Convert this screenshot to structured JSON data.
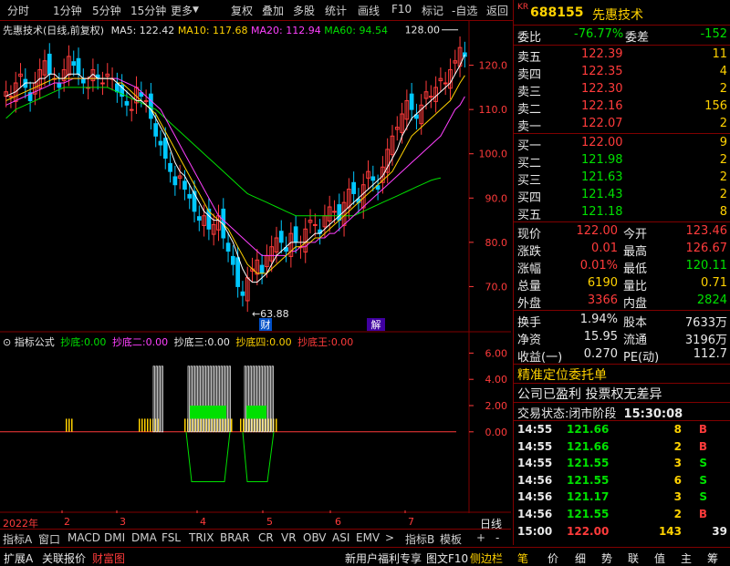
{
  "toolbar": {
    "left_items": [
      "分时",
      "1分钟",
      "5分钟",
      "15分钟",
      "更多"
    ],
    "right_items": [
      "复权",
      "叠加",
      "多股",
      "统计",
      "画线",
      "F10",
      "标记",
      "-自选",
      "返回"
    ]
  },
  "chart": {
    "stock_title": "先惠技术(日线,前复权)",
    "ma": [
      {
        "label": "MA5: 122.42",
        "color": "#ffffff"
      },
      {
        "label": "MA10: 117.68",
        "color": "#ffd200"
      },
      {
        "label": "MA20: 112.94",
        "color": "#ff40ff"
      },
      {
        "label": "MA60: 94.54",
        "color": "#00e000"
      }
    ],
    "high_label": "128.00",
    "low_label": "63.88",
    "markers": [
      "财",
      "解"
    ],
    "yaxis_ticks": [
      "120.0",
      "110.0",
      "100.0",
      "90.0",
      "80.0",
      "70.0"
    ],
    "indicator": {
      "name": "指标公式",
      "series": [
        {
          "label": "抄底:",
          "value": "0.00",
          "color": "#00e000"
        },
        {
          "label": "抄底二:",
          "value": "0.00",
          "color": "#ff40ff"
        },
        {
          "label": "抄底三:",
          "value": "0.00",
          "color": "#e8e8e8"
        },
        {
          "label": "抄底四:",
          "value": "0.00",
          "color": "#ffd200"
        },
        {
          "label": "抄底王:",
          "value": "0.00",
          "color": "#ff3b3b"
        }
      ],
      "yaxis_ticks": [
        "6.00",
        "4.00",
        "2.00",
        "0.00"
      ]
    },
    "xaxis": {
      "year": "2022年",
      "months": [
        "2",
        "3",
        "4",
        "5",
        "6",
        "7"
      ],
      "period": "日线"
    }
  },
  "chart_data": {
    "type": "candlestick",
    "title": "先惠技术(日线,前复权)",
    "ylim": [
      60,
      130
    ],
    "max_high": 128.0,
    "min_low": 63.88,
    "ma_last": {
      "MA5": 122.42,
      "MA10": 117.68,
      "MA20": 112.94,
      "MA60": 94.54
    },
    "close_series": [
      114,
      113,
      116,
      118,
      115,
      112,
      116,
      119,
      121,
      118,
      117,
      115,
      119,
      122,
      120,
      118,
      116,
      115,
      119,
      117,
      116,
      118,
      117,
      114,
      113,
      111,
      110,
      115,
      113,
      112,
      108,
      104,
      102,
      99,
      96,
      93,
      95,
      92,
      90,
      87,
      85,
      86,
      83,
      84,
      86,
      81,
      78,
      75,
      70,
      68,
      72,
      74,
      76,
      73,
      77,
      79,
      81,
      80,
      78,
      82,
      80,
      79,
      83,
      85,
      84,
      82,
      86,
      88,
      87,
      85,
      89,
      92,
      91,
      89,
      93,
      96,
      94,
      92,
      97,
      101,
      104,
      106,
      109,
      112,
      110,
      108,
      111,
      114,
      113,
      115,
      117,
      116,
      119,
      121,
      124,
      122
    ],
    "ma5": [
      113,
      113.5,
      114,
      115,
      116,
      116,
      116,
      117,
      117,
      118,
      118,
      117,
      117,
      118,
      118,
      118,
      117,
      117,
      118,
      117,
      117,
      117,
      117,
      116,
      115,
      114,
      113,
      112,
      112,
      111,
      110,
      108,
      106,
      104,
      101,
      98,
      96,
      95,
      93,
      91,
      89,
      87,
      86,
      85,
      85,
      84,
      82,
      80,
      77,
      74,
      72,
      71,
      71,
      72,
      73,
      75,
      77,
      78,
      79,
      80,
      80,
      80,
      80,
      81,
      82,
      82,
      83,
      84,
      85,
      86,
      87,
      88,
      89,
      90,
      91,
      92,
      93,
      94,
      95,
      97,
      99,
      101,
      104,
      106,
      108,
      109,
      110,
      111,
      112,
      113,
      114,
      115,
      116,
      118,
      120,
      122.42
    ],
    "ma10": [
      112,
      112.5,
      113,
      113.5,
      114,
      114.5,
      115,
      115.5,
      116,
      116.5,
      117,
      117,
      117,
      117,
      117,
      117,
      117,
      117,
      117,
      117,
      117,
      117,
      117,
      116,
      116,
      115,
      114,
      113,
      112,
      111,
      110,
      109,
      107,
      105,
      103,
      101,
      99,
      97,
      95,
      93,
      91,
      89,
      87,
      86,
      85,
      84,
      83,
      81,
      79,
      77,
      75,
      74,
      73,
      73,
      73,
      74,
      75,
      76,
      77,
      78,
      79,
      79,
      80,
      80,
      81,
      81,
      82,
      83,
      84,
      85,
      86,
      87,
      88,
      89,
      90,
      91,
      92,
      93,
      94,
      95,
      96,
      98,
      100,
      102,
      104,
      105,
      106,
      107,
      108,
      109,
      110,
      111,
      112,
      114,
      116,
      117.68
    ],
    "ma20": [
      111,
      111.5,
      112,
      112.5,
      113,
      113.5,
      114,
      114.5,
      115,
      115.5,
      116,
      116,
      116,
      116.5,
      117,
      117,
      117,
      117,
      117,
      117,
      117,
      117,
      117,
      117,
      116.5,
      116,
      115.5,
      115,
      114,
      113,
      112,
      111,
      110,
      108,
      106,
      104,
      102,
      100,
      98,
      96,
      94,
      92,
      90,
      88,
      86,
      85,
      84,
      83,
      82,
      81,
      80,
      79,
      78,
      77,
      77,
      77,
      77,
      77,
      77,
      78,
      78,
      79,
      79,
      80,
      80,
      81,
      81,
      82,
      82,
      83,
      84,
      85,
      86,
      87,
      88,
      89,
      90,
      91,
      92,
      93,
      94,
      95,
      96,
      97,
      98,
      99,
      100,
      101,
      102,
      103,
      104,
      106,
      108,
      110,
      111,
      112.94
    ],
    "ma60": [
      108,
      109,
      110,
      110.5,
      111,
      111.5,
      112,
      112.5,
      113,
      113.5,
      114,
      114.5,
      115,
      115,
      115,
      115,
      115,
      115,
      115,
      115,
      115,
      115,
      114.5,
      114,
      113.5,
      113,
      112.5,
      112,
      111.5,
      111,
      110.5,
      110,
      109,
      108,
      107,
      106,
      105,
      104,
      103,
      102,
      101,
      100,
      99,
      98,
      97,
      96,
      95,
      94,
      93,
      92,
      91,
      90.5,
      90,
      89.5,
      89,
      88.5,
      88,
      87.5,
      87,
      86.5,
      86,
      86,
      86,
      86,
      86,
      86,
      86,
      86,
      86,
      86,
      86,
      86,
      86,
      86.5,
      87,
      87.5,
      88,
      88.5,
      89,
      89.5,
      90,
      90.5,
      91,
      91.5,
      92,
      92.5,
      93,
      93.5,
      94,
      94.3,
      94.54
    ]
  },
  "quote": {
    "code": "688155",
    "name": "先惠技术",
    "kr_badge": "KR",
    "weibi_label": "委比",
    "weibi_value": "-76.77%",
    "weicha_label": "委差",
    "weicha_value": "-152",
    "asks": [
      {
        "label": "卖五",
        "price": "122.39",
        "vol": "11"
      },
      {
        "label": "卖四",
        "price": "122.35",
        "vol": "4"
      },
      {
        "label": "卖三",
        "price": "122.30",
        "vol": "2"
      },
      {
        "label": "卖二",
        "price": "122.16",
        "vol": "156"
      },
      {
        "label": "卖一",
        "price": "122.07",
        "vol": "2"
      }
    ],
    "bids": [
      {
        "label": "买一",
        "price": "122.00",
        "vol": "9"
      },
      {
        "label": "买二",
        "price": "121.98",
        "vol": "2"
      },
      {
        "label": "买三",
        "price": "121.63",
        "vol": "2"
      },
      {
        "label": "买四",
        "price": "121.43",
        "vol": "2"
      },
      {
        "label": "买五",
        "price": "121.18",
        "vol": "8"
      }
    ],
    "stats": [
      {
        "l1": "现价",
        "v1": "122.00",
        "c1": "red",
        "l2": "今开",
        "v2": "123.46",
        "c2": "red"
      },
      {
        "l1": "涨跌",
        "v1": "0.01",
        "c1": "red",
        "l2": "最高",
        "v2": "126.67",
        "c2": "red"
      },
      {
        "l1": "涨幅",
        "v1": "0.01%",
        "c1": "red",
        "l2": "最低",
        "v2": "120.11",
        "c2": "green"
      },
      {
        "l1": "总量",
        "v1": "6190",
        "c1": "yellow",
        "l2": "量比",
        "v2": "0.71",
        "c2": "yellow"
      },
      {
        "l1": "外盘",
        "v1": "3366",
        "c1": "red",
        "l2": "内盘",
        "v2": "2824",
        "c2": "green"
      }
    ],
    "fin": [
      {
        "l1": "换手",
        "v1": "1.94%",
        "l2": "股本",
        "v2": "7633万"
      },
      {
        "l1": "净资",
        "v1": "15.95",
        "l2": "流通",
        "v2": "3196万"
      },
      {
        "l1": "收益(一)",
        "v1": "0.270",
        "l2": "PE(动)",
        "v2": "112.7"
      }
    ],
    "notice1": "精准定位委托单",
    "notice2": "公司已盈利 投票权无差异",
    "trade_status_label": "交易状态:",
    "trade_status_value": "闭市阶段",
    "trade_time": "15:30:08",
    "ticks": [
      {
        "t": "14:55",
        "p": "121.66",
        "v": "8",
        "d": "B"
      },
      {
        "t": "14:55",
        "p": "121.66",
        "v": "2",
        "d": "B"
      },
      {
        "t": "14:55",
        "p": "121.55",
        "v": "3",
        "d": "S"
      },
      {
        "t": "14:56",
        "p": "121.55",
        "v": "6",
        "d": "S"
      },
      {
        "t": "14:56",
        "p": "121.17",
        "v": "3",
        "d": "S"
      },
      {
        "t": "14:56",
        "p": "121.55",
        "v": "2",
        "d": "B"
      },
      {
        "t": "15:00",
        "p": "122.00",
        "v": "143",
        "d": "39"
      }
    ]
  },
  "tabs": [
    "指标A",
    "窗口",
    "MACD",
    "DMI",
    "DMA",
    "FSL",
    "TRIX",
    "BRAR",
    "CR",
    "VR",
    "OBV",
    "ASI",
    "EMV",
    ">",
    "指标B",
    "模板",
    "+",
    "-"
  ],
  "statusbar": {
    "left": [
      "扩展A",
      "关联报价",
      "财富图"
    ],
    "mid": [
      "新用户福利专享",
      "图文F10",
      "侧边栏"
    ],
    "right": [
      "笔",
      "价",
      "细",
      "势",
      "联",
      "值",
      "主",
      "筹"
    ]
  }
}
